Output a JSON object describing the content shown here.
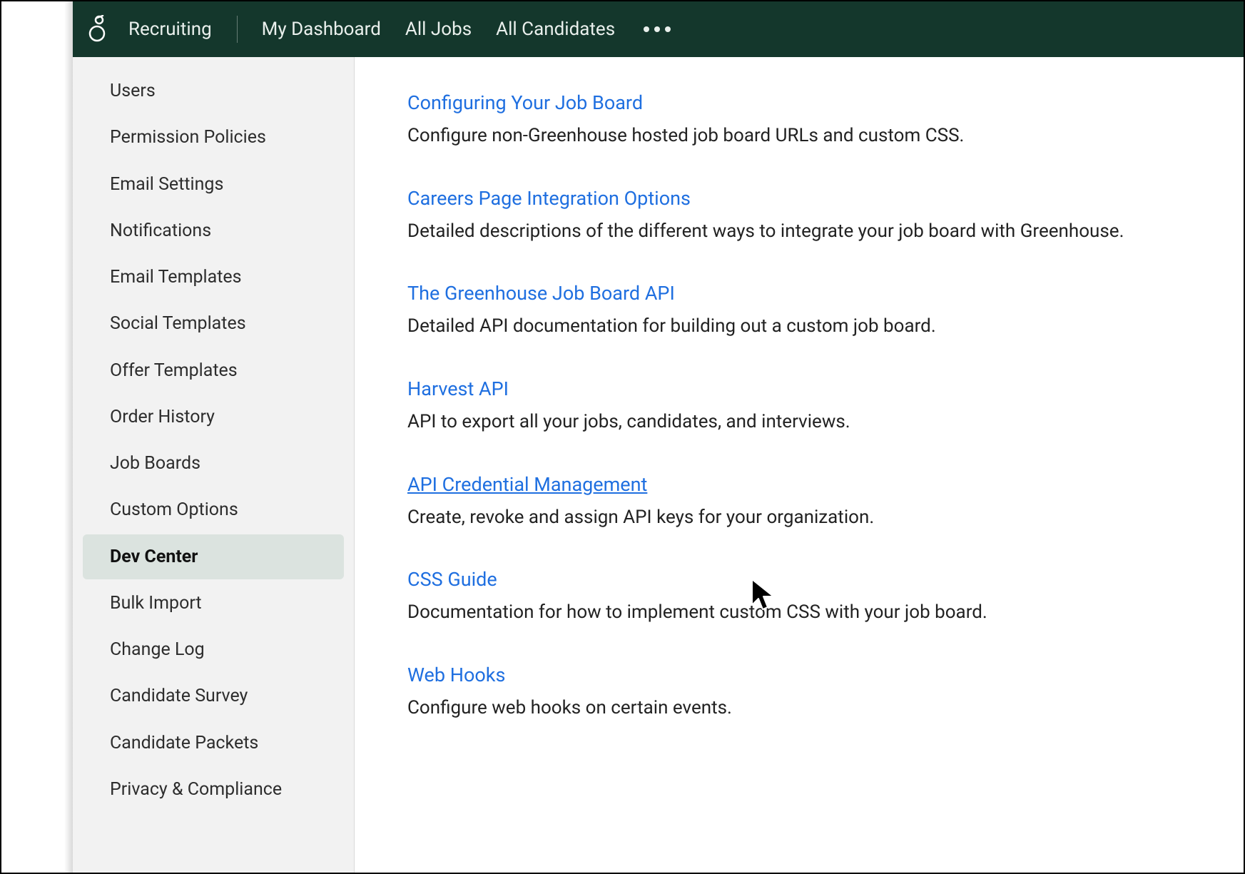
{
  "topnav": {
    "brand": "Recruiting",
    "items": [
      "My Dashboard",
      "All Jobs",
      "All Candidates"
    ]
  },
  "sidebar": {
    "items": [
      {
        "label": "Users",
        "active": false
      },
      {
        "label": "Permission Policies",
        "active": false
      },
      {
        "label": "Email Settings",
        "active": false
      },
      {
        "label": "Notifications",
        "active": false
      },
      {
        "label": "Email Templates",
        "active": false
      },
      {
        "label": "Social Templates",
        "active": false
      },
      {
        "label": "Offer Templates",
        "active": false
      },
      {
        "label": "Order History",
        "active": false
      },
      {
        "label": "Job Boards",
        "active": false
      },
      {
        "label": "Custom Options",
        "active": false
      },
      {
        "label": "Dev Center",
        "active": true
      },
      {
        "label": "Bulk Import",
        "active": false
      },
      {
        "label": "Change Log",
        "active": false
      },
      {
        "label": "Candidate Survey",
        "active": false
      },
      {
        "label": "Candidate Packets",
        "active": false
      },
      {
        "label": "Privacy & Compliance",
        "active": false
      }
    ]
  },
  "content": {
    "hovered_index": 4,
    "blocks": [
      {
        "title": "Configuring Your Job Board",
        "desc": "Configure non-Greenhouse hosted job board URLs and custom CSS."
      },
      {
        "title": "Careers Page Integration Options",
        "desc": "Detailed descriptions of the different ways to integrate your job board with Greenhouse."
      },
      {
        "title": "The Greenhouse Job Board API",
        "desc": "Detailed API documentation for building out a custom job board."
      },
      {
        "title": "Harvest API",
        "desc": "API to export all your jobs, candidates, and interviews."
      },
      {
        "title": "API Credential Management",
        "desc": "Create, revoke and assign API keys for your organization."
      },
      {
        "title": "CSS Guide",
        "desc": "Documentation for how to implement custom CSS with your job board."
      },
      {
        "title": "Web Hooks",
        "desc": "Configure web hooks on certain events."
      }
    ]
  }
}
